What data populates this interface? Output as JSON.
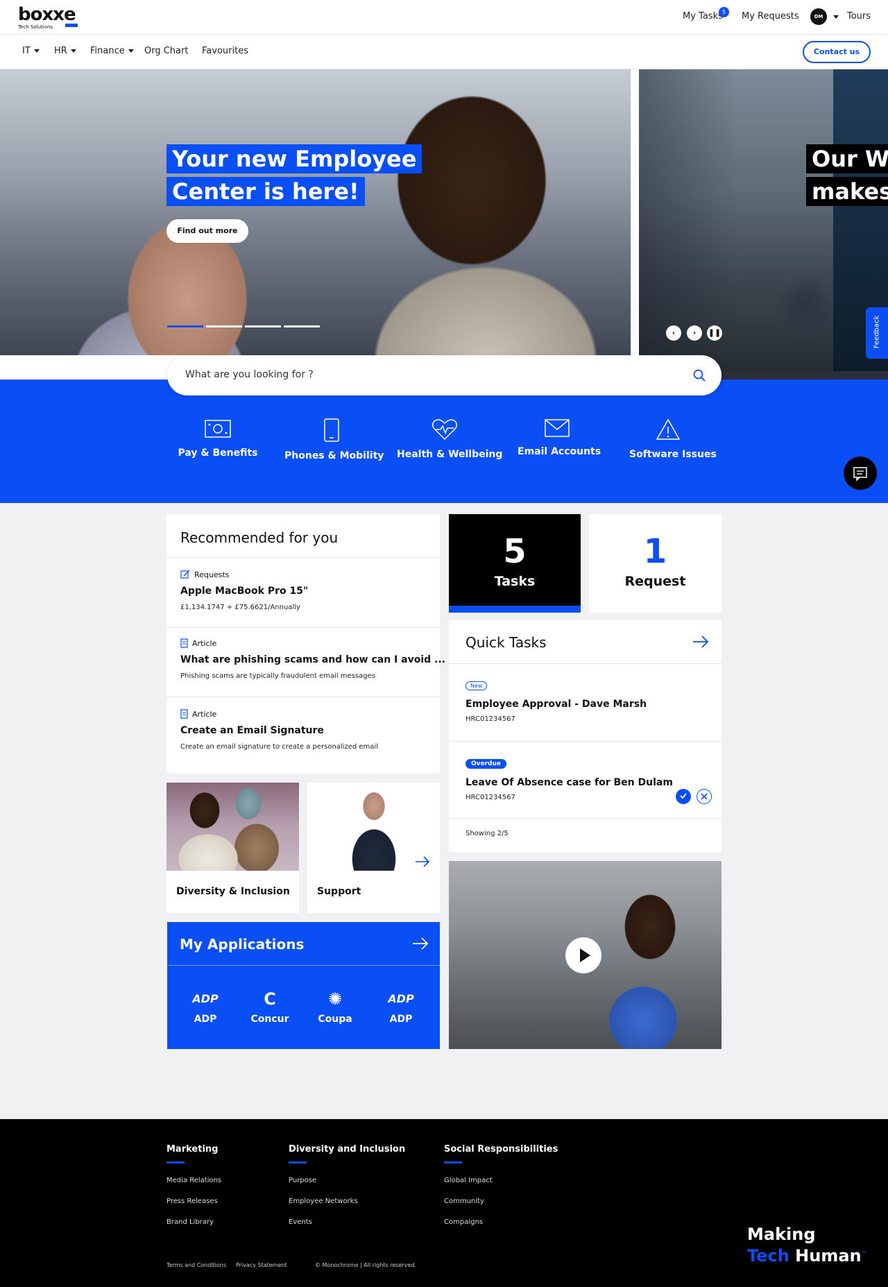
{
  "header": {
    "logo_text": "boxxe",
    "logo_sub": "Tech Solutions",
    "my_tasks_label": "My Tasks",
    "tasks_badge": "5",
    "my_requests_label": "My Requests",
    "avatar_initials": "DM",
    "tours_label": "Tours"
  },
  "nav": {
    "items": [
      "IT",
      "HR",
      "Finance",
      "Org Chart",
      "Favourites"
    ],
    "contact_label": "Contact us"
  },
  "hero": {
    "slide1_line1": "Your new Employee",
    "slide1_line2": "Center is here!",
    "cta_label": "Find out more",
    "slide2_line1": "Our Wo",
    "slide2_line2": "makes",
    "feedback_label": "Feedback"
  },
  "search": {
    "placeholder": "What are you looking for ?"
  },
  "categories": [
    {
      "label": "Pay & Benefits",
      "icon": "money-icon"
    },
    {
      "label": "Phones & Mobility",
      "icon": "phone-icon"
    },
    {
      "label": "Health & Wellbeing",
      "icon": "heart-pulse-icon"
    },
    {
      "label": "Email Accounts",
      "icon": "envelope-icon"
    },
    {
      "label": "Software Issues",
      "icon": "warning-icon"
    }
  ],
  "recommended": {
    "title": "Recommended for you",
    "items": [
      {
        "type": "Requests",
        "name": "Apple MacBook Pro 15\"",
        "desc": "£1,134.1747 + £75.6621/Annually"
      },
      {
        "type": "Article",
        "name": "What are phishing scams and how can I avoid ...",
        "desc": "Phishing scams are typically fraudulent email messages"
      },
      {
        "type": "Article",
        "name": "Create an Email Signature",
        "desc": "Create an email signature to create a personalized email"
      }
    ]
  },
  "stats": {
    "tasks_num": "5",
    "tasks_label": "Tasks",
    "request_num": "1",
    "request_label": "Request"
  },
  "quick_tasks": {
    "title": "Quick Tasks",
    "items": [
      {
        "status": "New",
        "name": "Employee Approval - Dave Marsh",
        "ref": "HRC01234567"
      },
      {
        "status": "Overdue",
        "name": "Leave Of Absence case for Ben Dulam",
        "ref": "HRC01234567"
      }
    ],
    "showing": "Showing 2/5"
  },
  "tiles": {
    "diversity_label": "Diversity & Inclusion",
    "support_label": "Support"
  },
  "applications": {
    "title": "My Applications",
    "apps": [
      {
        "label": "ADP",
        "logo": "ADP"
      },
      {
        "label": "Concur",
        "logo": "C"
      },
      {
        "label": "Coupa",
        "logo": "✺"
      },
      {
        "label": "ADP",
        "logo": "ADP"
      }
    ]
  },
  "footer": {
    "columns": [
      {
        "title": "Marketing",
        "links": [
          "Media Relations",
          "Press Releases",
          "Brand Library"
        ]
      },
      {
        "title": "Diversity and Inclusion",
        "links": [
          "Purpose",
          "Employee Networks",
          "Events"
        ]
      },
      {
        "title": "Social Responsibilities",
        "links": [
          "Global Impact",
          "Community",
          "Compaigns"
        ]
      }
    ],
    "terms": "Terms and Conditions",
    "privacy": "Privacy Statement",
    "copyright": "© Monochrome | All rights reserved.",
    "tagline_1": "Making",
    "tagline_2a": "Tech",
    "tagline_2b": "Human",
    "tm": "™"
  },
  "colors": {
    "accent": "#0a4ff5",
    "dark": "#000000"
  }
}
